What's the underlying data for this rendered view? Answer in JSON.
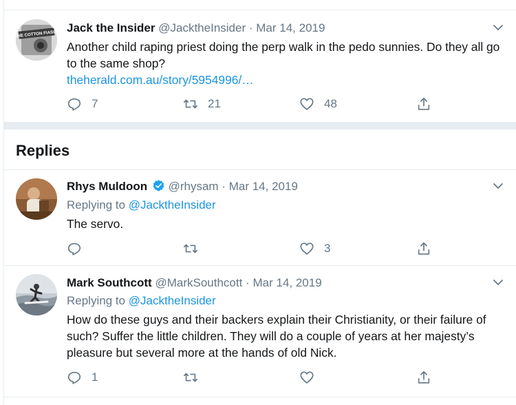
{
  "main_tweet": {
    "fullname": "Jack the Insider",
    "handle": "@JacktheInsider",
    "separator": "·",
    "date": "Mar 14, 2019",
    "text": "Another child raping priest doing the perp walk in the pedo sunnies. Do they all go to the same shop?",
    "link": "theherald.com.au/story/5954996/…",
    "avatar_caption": "FINE COTTON FIASCO",
    "reply_count": "7",
    "retweet_count": "21",
    "like_count": "48"
  },
  "replies_heading": "Replies",
  "replies": [
    {
      "fullname": "Rhys Muldoon",
      "verified": true,
      "handle": "@rhysam",
      "separator": "·",
      "date": "Mar 14, 2019",
      "replying_prefix": "Replying to",
      "replying_to": "@JacktheInsider",
      "text": "The servo.",
      "reply_count": "",
      "retweet_count": "",
      "like_count": "3"
    },
    {
      "fullname": "Mark Southcott",
      "verified": false,
      "handle": "@MarkSouthcott",
      "separator": "·",
      "date": "Mar 14, 2019",
      "replying_prefix": "Replying to",
      "replying_to": "@JacktheInsider",
      "text": "How do these guys and their backers explain their Christianity, or their failure of such? Suffer the little children. They will do a couple of years at her majesty’s pleasure but several more at the hands of old Nick.",
      "reply_count": "1",
      "retweet_count": "",
      "like_count": ""
    }
  ],
  "colors": {
    "text": "#14171a",
    "secondary": "#657786",
    "link": "#1b95e0",
    "divider": "#e6ecf0",
    "verified": "#1da1f2"
  },
  "icons": [
    "reply-icon",
    "retweet-icon",
    "like-icon",
    "share-icon",
    "caret-down-icon",
    "verified-badge-icon"
  ]
}
